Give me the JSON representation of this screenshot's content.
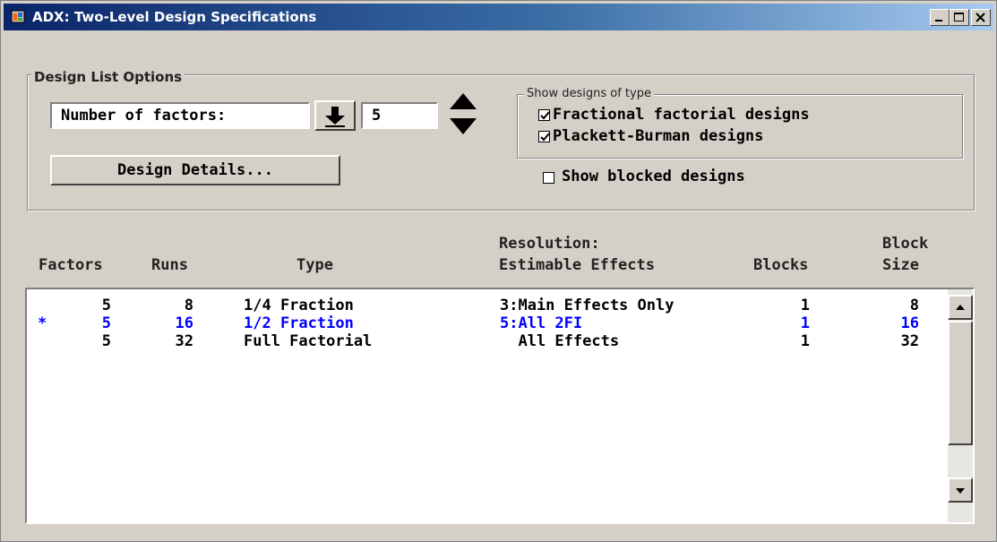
{
  "window": {
    "title": "ADX: Two-Level Design Specifications"
  },
  "design_list_options": {
    "group_label": "Design List Options",
    "number_of_factors_label": "Number of factors:",
    "number_of_factors_value": "5",
    "design_details_button": "Design Details..."
  },
  "show_designs": {
    "group_label": "Show designs of type",
    "fractional_factorial": {
      "label": "Fractional factorial designs",
      "checked": true
    },
    "plackett_burman": {
      "label": "Plackett-Burman designs",
      "checked": true
    }
  },
  "show_blocked": {
    "label": "Show blocked designs",
    "checked": false
  },
  "table": {
    "headers": {
      "factors": "Factors",
      "runs": "Runs",
      "type": "Type",
      "resolution_line1": "Resolution:",
      "resolution_line2": "Estimable Effects",
      "blocks": "Blocks",
      "block_size_line1": "Block",
      "block_size_line2": "Size"
    },
    "rows": [
      {
        "marker": "",
        "factors": "5",
        "runs": "8",
        "type": "1/4 Fraction",
        "resolution": "3:Main Effects Only",
        "blocks": "1",
        "block_size": "8"
      },
      {
        "marker": "*",
        "factors": "5",
        "runs": "16",
        "type": "1/2 Fraction",
        "resolution": "5:All 2FI",
        "blocks": "1",
        "block_size": "16"
      },
      {
        "marker": "",
        "factors": "5",
        "runs": "32",
        "type": "Full Factorial",
        "resolution": "  All Effects",
        "blocks": "1",
        "block_size": "32"
      }
    ]
  },
  "colors": {
    "selected_row": "#0000ff",
    "normal_row": "#000000",
    "title_bar": "#0a246a"
  },
  "icons": {
    "app": "sas-app-icon",
    "minimize": "minimize-icon",
    "maximize": "maximize-icon",
    "close": "close-icon",
    "dropdown": "down-arrow-icon",
    "spin_up": "triangle-up-icon",
    "spin_down": "triangle-down-icon",
    "scroll_up": "scroll-up-icon",
    "scroll_down": "scroll-down-icon"
  }
}
